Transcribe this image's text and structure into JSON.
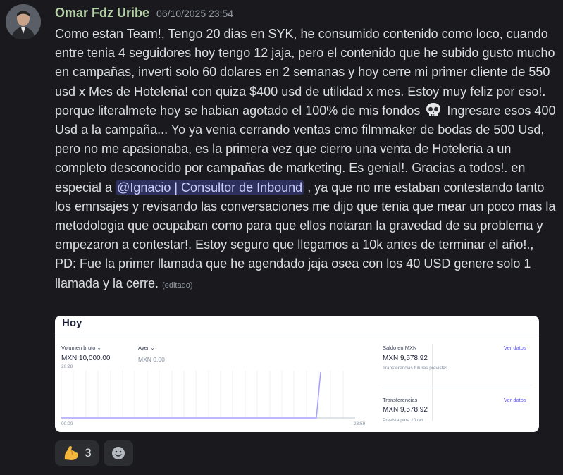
{
  "message": {
    "author": "Omar Fdz Uribe",
    "timestamp": "06/10/2025 23:54",
    "text_part1": "Como estan Team!, Tengo 20 dias en SYK, he consumido contenido como loco, cuando entre tenia 4 seguidores hoy tengo 12 jaja,  pero el contenido que he subido gusto mucho en campañas, inverti solo 60 dolares en 2 semanas y hoy cerre mi primer cliente de 550 usd x Mes de Hoteleria!  con quiza $400 usd de utilidad x mes. Estoy muy feliz por eso!. porque literalmete hoy se habian agotado el 100% de mis fondos",
    "text_part2": " Ingresare esos 400 Usd a la campaña... Yo ya venia cerrando ventas cmo filmmaker de bodas de 500 Usd, pero no me apasionaba, es la primera vez que cierro una venta de Hoteleria a un completo desconocido por campañas de marketing. Es genial!.  Gracias a todos!. en especial a ",
    "mention": "@Ignacio | Consultor de Inbound",
    "text_part3": " , ya que no me estaban contestando tanto los emnsajes y revisando las conversaciones me dijo que tenia que mear un poco mas la metodologia que ocupaban como para que ellos notaran la gravedad de su problema y empezaron a contestar!. Estoy seguro que llegamos a 10k antes de terminar el año!., PD: Fue la primer llamada que he agendado jaja osea con los 40 USD genere solo 1 llamada y la cerre. ",
    "edited": "(editado)",
    "skull_icon": "skull-emoji"
  },
  "attachment": {
    "title": "Hoy",
    "gross_volume_label": "Volumen bruto",
    "gross_volume_value": "MXN 10,000.00",
    "time_label": "20:28",
    "yesterday_label": "Ayer",
    "yesterday_value": "MXN 0.00",
    "axis_start": "00:00",
    "axis_end": "23:59",
    "balance_label": "Saldo en MXN",
    "balance_value": "MXN 9,578.92",
    "balance_sub": "Transferencias futuras previstas",
    "balance_link": "Ver datos",
    "transfers_label": "Transferencias",
    "transfers_value": "MXN 9,578.92",
    "transfers_sub": "Prevista para 10 oct",
    "transfers_link": "Ver datos",
    "line_color": "#a8a0ff"
  },
  "reactions": [
    {
      "icon": "flexed-biceps-emoji",
      "count": "3"
    },
    {
      "icon": "add-reaction-icon"
    }
  ],
  "colors": {
    "background": "#1a1a1e",
    "username": "#b5d1a8",
    "mention_bg": "#3c4270",
    "accent": "#635bff"
  }
}
